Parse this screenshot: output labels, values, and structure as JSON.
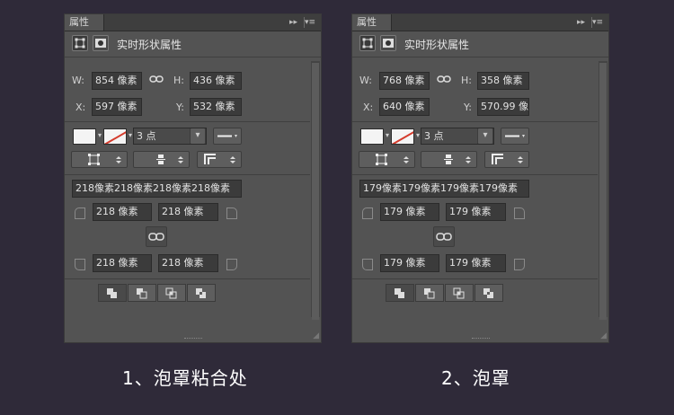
{
  "panels": [
    {
      "tab": "属性",
      "header_title": "实时形状属性",
      "w_label": "W:",
      "w_value": "854 像素",
      "h_label": "H:",
      "h_value": "436 像素",
      "x_label": "X:",
      "x_value": "597 像素",
      "y_label": "Y:",
      "y_value": "532 像素",
      "stroke_width": "3 点",
      "corner_all": "218像素218像素218像素218像素",
      "corner_tl": "218 像素",
      "corner_tr": "218 像素",
      "corner_bl": "218 像素",
      "corner_br": "218 像素"
    },
    {
      "tab": "属性",
      "header_title": "实时形状属性",
      "w_label": "W:",
      "w_value": "768 像素",
      "h_label": "H:",
      "h_value": "358 像素",
      "x_label": "X:",
      "x_value": "640 像素",
      "y_label": "Y:",
      "y_value": "570.99 像",
      "stroke_width": "3 点",
      "corner_all": "179像素179像素179像素179像素",
      "corner_tl": "179 像素",
      "corner_tr": "179 像素",
      "corner_bl": "179 像素",
      "corner_br": "179 像素"
    }
  ],
  "icons": {
    "collapse": "double-chevron-right-icon",
    "menu": "panel-menu-icon",
    "link": "chain-link-icon"
  },
  "glyphs": {
    "collapse": "▸▸",
    "menu": "▾≡",
    "link": "⛓",
    "dd_arrow": "⬍",
    "dd_down": "▾"
  },
  "captions": {
    "left": "1、泡罩粘合处",
    "right": "2、泡罩"
  },
  "colors": {
    "background": "#2f2a39",
    "panel": "#535353",
    "field": "#3b3b3b",
    "stroke_swatch_line": "#d43b2c"
  }
}
